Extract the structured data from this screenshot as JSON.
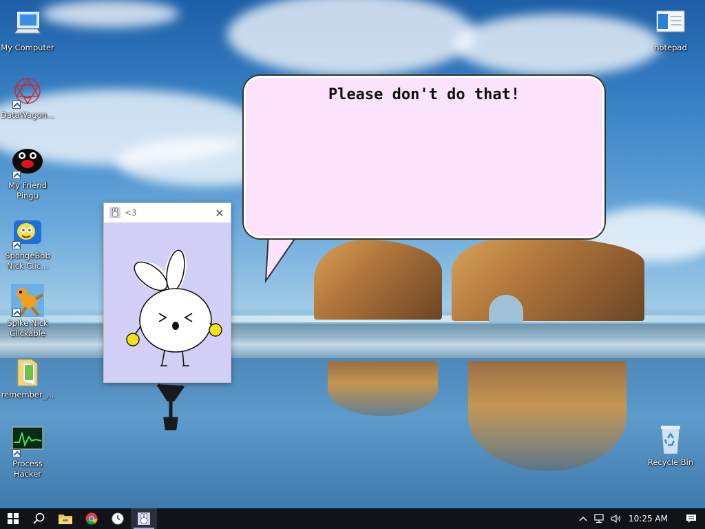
{
  "desktop": {
    "icons_left": [
      {
        "label": "My Computer",
        "icon": "computer-icon"
      },
      {
        "label": "DataWagon...",
        "icon": "datawagon-icon"
      },
      {
        "label": "My Friend Pingu",
        "icon": "penguin-icon"
      },
      {
        "label": "SpongeBob Nick Clic...",
        "icon": "spongebob-icon"
      },
      {
        "label": "Spike Nick Clickable",
        "icon": "spike-icon"
      },
      {
        "label": "remember_...",
        "icon": "folder-icon"
      },
      {
        "label": "Process Hacker",
        "icon": "process-hacker-icon"
      }
    ],
    "icons_right": [
      {
        "label": "notepad",
        "icon": "notepad-icon"
      },
      {
        "label": "Recycle Bin",
        "icon": "recycle-bin-icon"
      }
    ]
  },
  "bubble": {
    "text": "Please don't do that!"
  },
  "pet_window": {
    "title": "<3",
    "close_glyph": "✕"
  },
  "taskbar": {
    "buttons": [
      "windows-start-icon",
      "search-icon",
      "file-explorer-icon",
      "chrome-icon",
      "clock-app-icon",
      "bunny-app-icon"
    ],
    "active": "bunny-app-icon",
    "clock": "10:25 AM"
  },
  "colors": {
    "bubble_bg": "#fbe3fb",
    "pet_canvas_bg": "#d3d0f7",
    "taskbar_bg": "#101418"
  }
}
